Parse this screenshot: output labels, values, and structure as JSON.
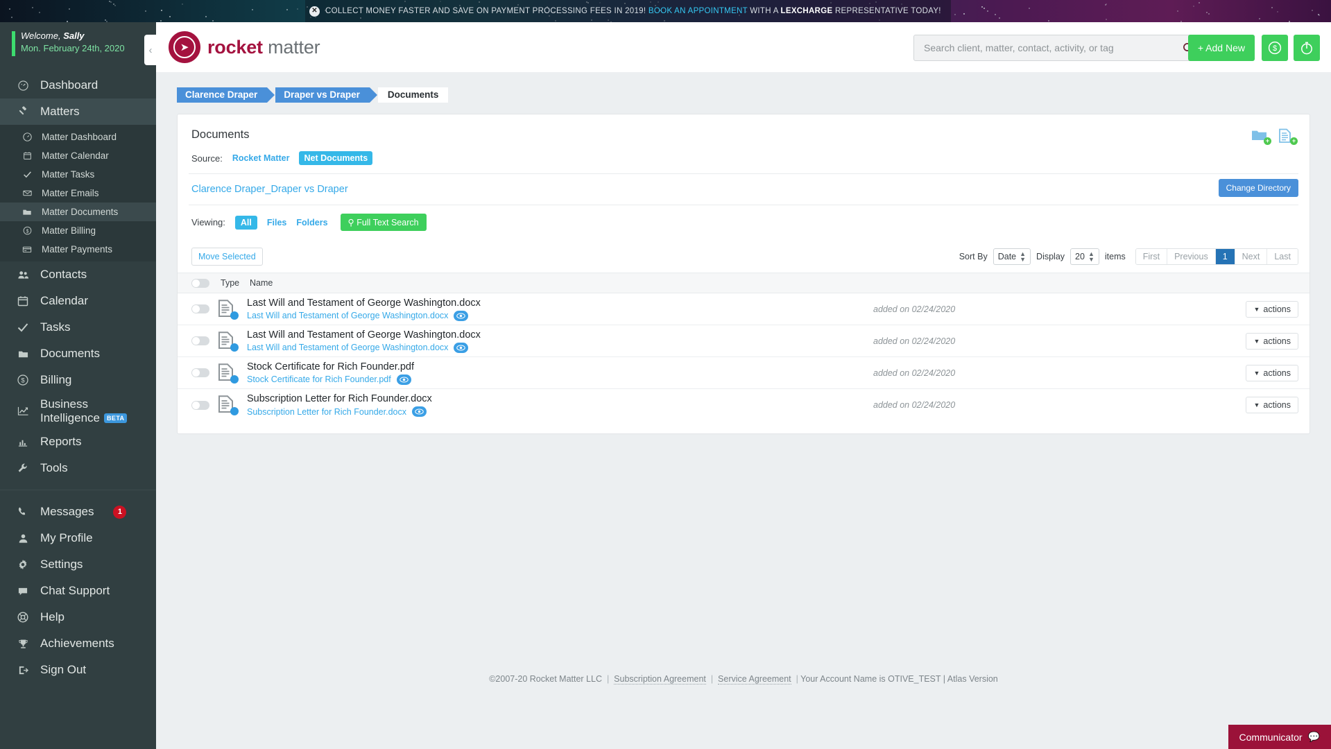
{
  "promo": {
    "close_icon": "close-icon",
    "text_1": "COLLECT MONEY FASTER AND SAVE ON PAYMENT PROCESSING FEES IN 2019!",
    "link": "BOOK AN APPOINTMENT",
    "text_2": "WITH A",
    "brand": "LEXCHARGE",
    "text_3": "REPRESENTATIVE TODAY!"
  },
  "sidebar": {
    "welcome_greeting": "Welcome,",
    "welcome_user": "Sally",
    "welcome_date": "Mon. February 24th, 2020",
    "collapse_icon": "chevron-left-icon",
    "items": [
      {
        "label": "Dashboard",
        "icon": "dashboard-icon"
      },
      {
        "label": "Matters",
        "icon": "gavel-icon"
      },
      {
        "label": "Contacts",
        "icon": "contacts-icon"
      },
      {
        "label": "Calendar",
        "icon": "calendar-icon"
      },
      {
        "label": "Tasks",
        "icon": "check-icon"
      },
      {
        "label": "Documents",
        "icon": "folder-icon"
      },
      {
        "label": "Billing",
        "icon": "dollar-circle-icon"
      },
      {
        "label": "Business Intelligence",
        "icon": "line-chart-icon",
        "badge": "BETA"
      },
      {
        "label": "Reports",
        "icon": "bar-chart-icon"
      },
      {
        "label": "Tools",
        "icon": "wrench-icon"
      }
    ],
    "subitems": [
      {
        "label": "Matter Dashboard",
        "icon": "dashboard-icon"
      },
      {
        "label": "Matter Calendar",
        "icon": "calendar-icon"
      },
      {
        "label": "Matter Tasks",
        "icon": "check-icon"
      },
      {
        "label": "Matter Emails",
        "icon": "envelope-icon"
      },
      {
        "label": "Matter Documents",
        "icon": "folder-icon"
      },
      {
        "label": "Matter Billing",
        "icon": "dollar-circle-icon"
      },
      {
        "label": "Matter Payments",
        "icon": "credit-card-icon"
      }
    ],
    "bottom_items": [
      {
        "label": "Messages",
        "icon": "phone-icon",
        "count": "1"
      },
      {
        "label": "My Profile",
        "icon": "user-icon"
      },
      {
        "label": "Settings",
        "icon": "gear-icon"
      },
      {
        "label": "Chat Support",
        "icon": "chat-icon"
      },
      {
        "label": "Help",
        "icon": "lifering-icon"
      },
      {
        "label": "Achievements",
        "icon": "trophy-icon"
      },
      {
        "label": "Sign Out",
        "icon": "signout-icon"
      }
    ]
  },
  "header": {
    "logo_bold": "rocket",
    "logo_light": " matter",
    "logo_icon": "rocket-icon",
    "search_placeholder": "Search client, matter, contact, activity, or tag",
    "search_value": "",
    "search_icon": "search-icon",
    "search_settings_icon": "gear-icon",
    "add_new_label": "+ Add New",
    "money_icon": "dollar-circle-icon",
    "timer_icon": "stopwatch-icon"
  },
  "breadcrumbs": [
    {
      "label": "Clarence Draper",
      "current": false
    },
    {
      "label": "Draper vs Draper",
      "current": false
    },
    {
      "label": "Documents",
      "current": true
    }
  ],
  "documents_panel": {
    "title": "Documents",
    "new_folder_icon": "folder-plus-icon",
    "new_document_icon": "document-plus-icon",
    "source_label": "Source:",
    "source_options": [
      {
        "label": "Rocket Matter",
        "selected": false
      },
      {
        "label": "Net Documents",
        "selected": true
      }
    ],
    "directory_path": "Clarence Draper_Draper vs Draper",
    "change_directory_label": "Change Directory",
    "viewing_label": "Viewing:",
    "viewing_options": [
      {
        "label": "All",
        "selected": true
      },
      {
        "label": "Files",
        "selected": false
      },
      {
        "label": "Folders",
        "selected": false
      }
    ],
    "full_text_search_label": "Full Text Search",
    "full_text_search_icon": "search-icon",
    "move_selected_label": "Move Selected",
    "sort_by_label": "Sort By",
    "sort_by_value": "Date",
    "display_label": "Display",
    "display_value": "20",
    "items_label": "items",
    "pagination": [
      {
        "label": "First",
        "current": false
      },
      {
        "label": "Previous",
        "current": false
      },
      {
        "label": "1",
        "current": true
      },
      {
        "label": "Next",
        "current": false
      },
      {
        "label": "Last",
        "current": false
      }
    ],
    "columns": {
      "type": "Type",
      "name": "Name"
    },
    "actions_label": "actions",
    "rows": [
      {
        "name": "Last Will and Testament of George Washington.docx",
        "sub": "Last Will and Testament of George Washington.docx",
        "added": "added on 02/24/2020",
        "type_icon": "document-icon",
        "preview_icon": "eye-icon"
      },
      {
        "name": "Last Will and Testament of George Washington.docx",
        "sub": "Last Will and Testament of George Washington.docx",
        "added": "added on 02/24/2020",
        "type_icon": "document-icon",
        "preview_icon": "eye-icon"
      },
      {
        "name": "Stock Certificate for Rich Founder.pdf",
        "sub": "Stock Certificate for Rich Founder.pdf",
        "added": "added on 02/24/2020",
        "type_icon": "document-icon",
        "preview_icon": "eye-icon"
      },
      {
        "name": "Subscription Letter for Rich Founder.docx",
        "sub": "Subscription Letter for Rich Founder.docx",
        "added": "added on 02/24/2020",
        "type_icon": "document-icon",
        "preview_icon": "eye-icon"
      }
    ]
  },
  "footer": {
    "copyright": "©2007-20 Rocket Matter LLC",
    "subscription_agreement": "Subscription Agreement",
    "service_agreement": "Service Agreement",
    "account_info": "Your Account Name is OTIVE_TEST | Atlas Version"
  },
  "communicator": {
    "label": "Communicator",
    "icon": "chat-bubble-icon"
  },
  "colors": {
    "sidebar_bg": "#313f41",
    "accent_green": "#3ecf5c",
    "accent_blue": "#35a9e8",
    "crumb_blue": "#4a90d9",
    "brand_red": "#a4123f",
    "badge_red": "#cc1122",
    "communicator_bg": "#9b1239"
  }
}
